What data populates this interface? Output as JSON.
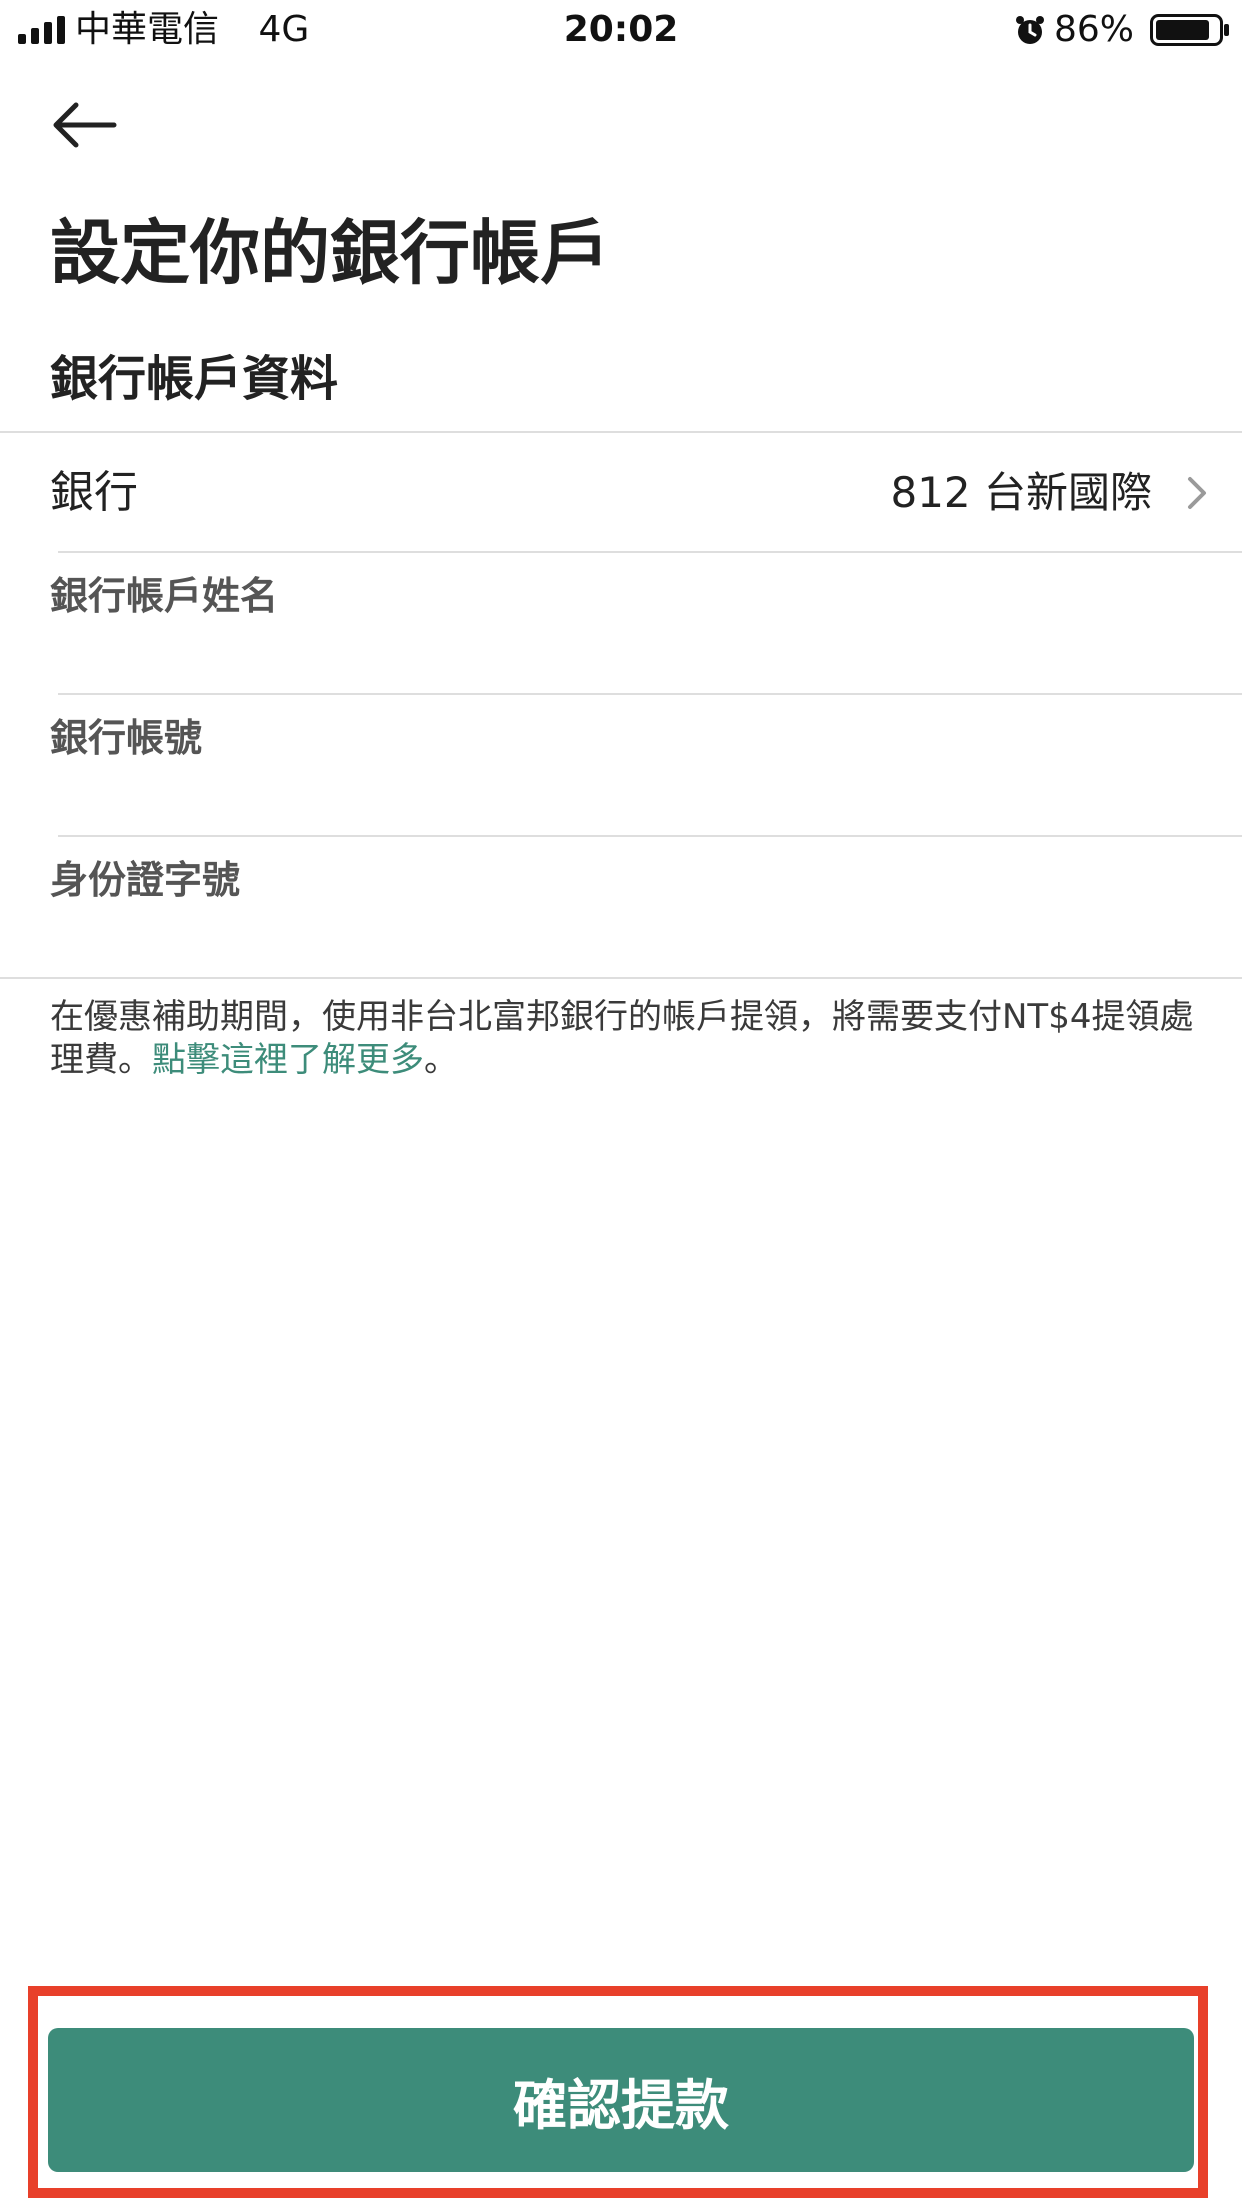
{
  "status_bar": {
    "carrier": "中華電信",
    "network": "4G",
    "time": "20:02",
    "battery": "86%",
    "battery_level": 0.86
  },
  "header": {
    "back_icon": "arrow-left-icon",
    "title": "設定你的銀行帳戶"
  },
  "section_title": "銀行帳戶資料",
  "bank_row": {
    "label": "銀行",
    "value": "812 台新國際",
    "chevron_icon": "chevron-right-icon"
  },
  "fields": {
    "account_name": {
      "label": "銀行帳戶姓名",
      "value": ""
    },
    "account_number": {
      "label": "銀行帳號",
      "value": ""
    },
    "id_number": {
      "label": "身份證字號",
      "value": ""
    }
  },
  "notice": {
    "text": "在優惠補助期間，使用非台北富邦銀行的帳戶提領，將需要支付NT$4提領處理費。",
    "link": "點擊這裡了解更多",
    "suffix": "。"
  },
  "confirm_button": "確認提款",
  "colors": {
    "accent": "#3d8c7a",
    "highlight": "#e8402a"
  }
}
